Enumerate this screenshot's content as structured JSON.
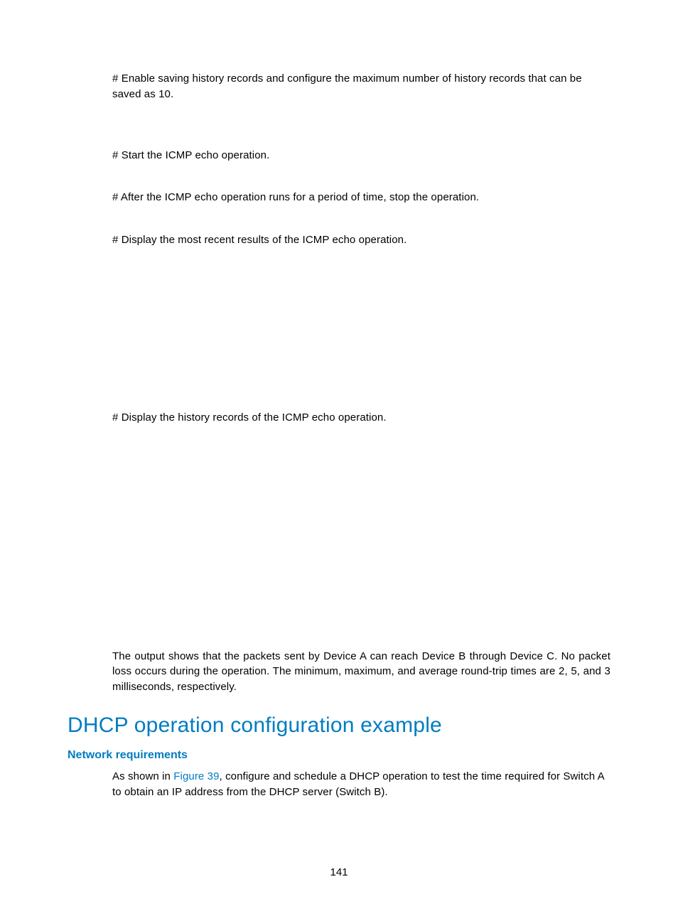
{
  "body": {
    "p1": "# Enable saving history records and configure the maximum number of history records that can be saved as 10.",
    "p2": "# Start the ICMP echo operation.",
    "p3": "# After the ICMP echo operation runs for a period of time, stop the operation.",
    "p4": "# Display the most recent results of the ICMP echo operation.",
    "p5": "# Display the history records of the ICMP echo operation.",
    "p6": "The output shows that the packets sent by Device A can reach Device B through Device C. No packet loss occurs during the operation. The minimum, maximum, and average round-trip times are 2, 5, and 3 milliseconds, respectively."
  },
  "section": {
    "title": "DHCP operation configuration example",
    "sub1": "Network requirements",
    "sub1_body_pre": "As shown in ",
    "sub1_link": "Figure 39",
    "sub1_body_post": ", configure and schedule a DHCP operation to test the time required for Switch A to obtain an IP address from the DHCP server (Switch B)."
  },
  "page_number": "141"
}
